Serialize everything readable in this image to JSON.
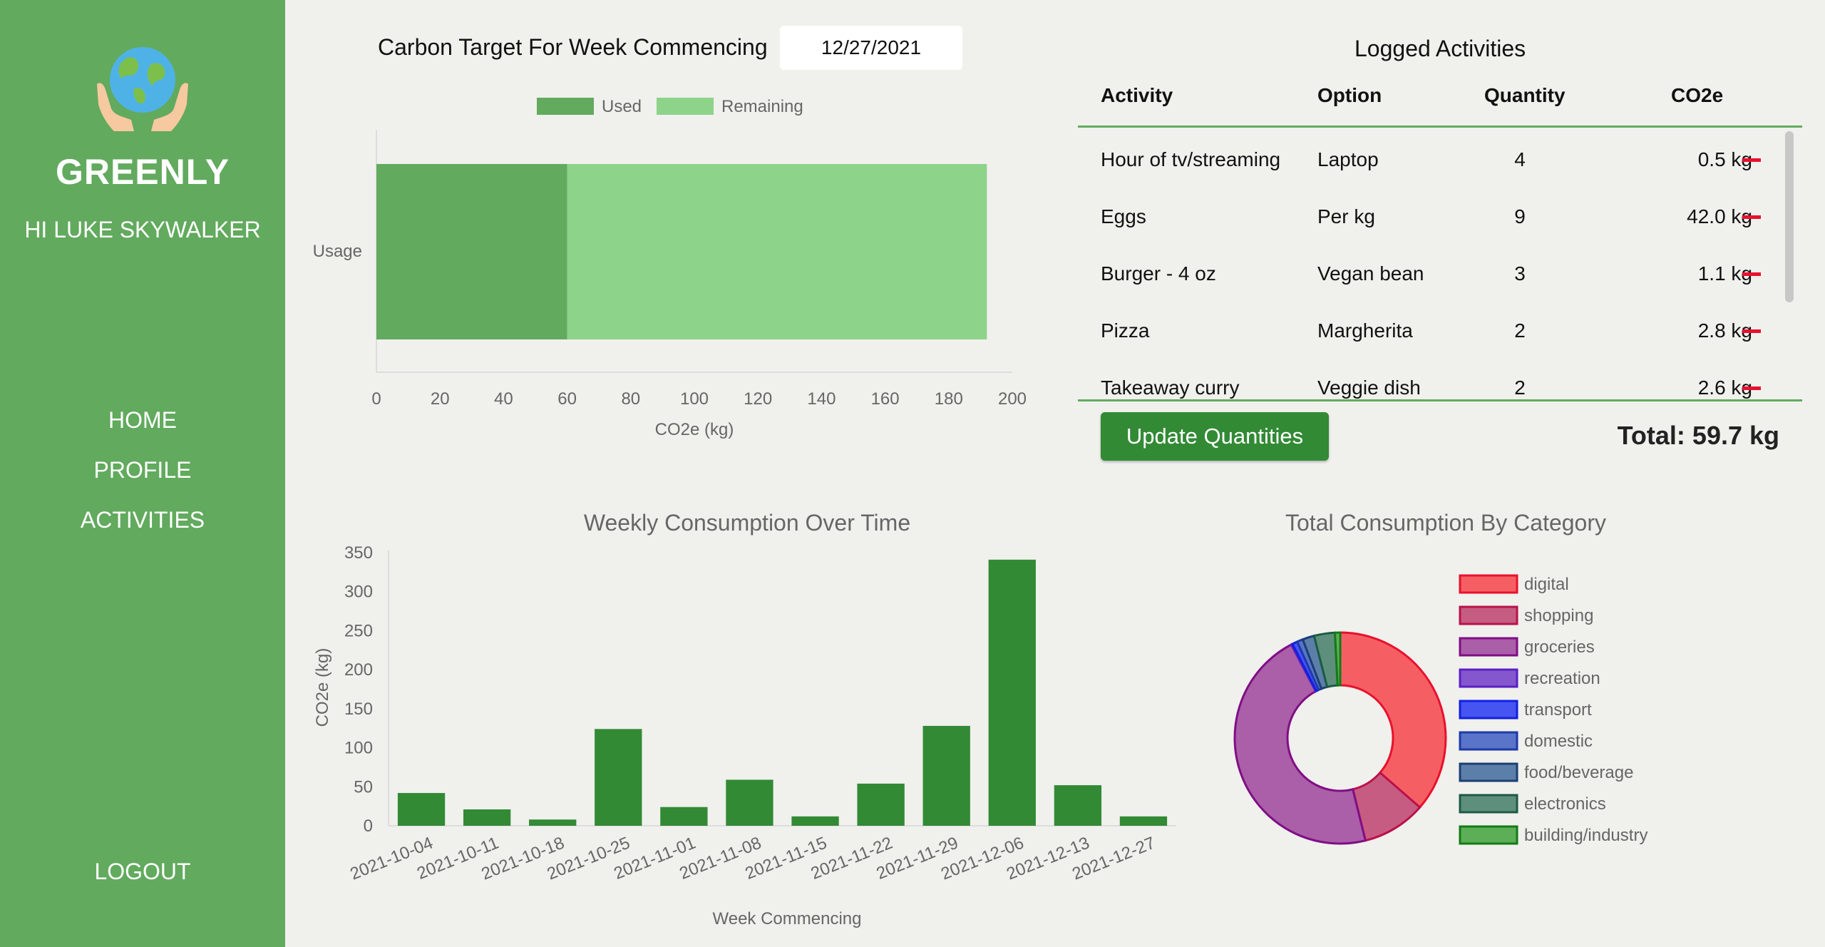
{
  "sidebar": {
    "brand": "GREENLY",
    "greeting": "HI LUKE SKYWALKER",
    "nav": [
      "HOME",
      "PROFILE",
      "ACTIVITIES"
    ],
    "logout": "LOGOUT"
  },
  "target": {
    "label": "Carbon Target For Week Commencing",
    "date": "12/27/2021"
  },
  "usage_chart": {
    "legend": [
      "Used",
      "Remaining"
    ],
    "colors": [
      "#62aa5e",
      "#8dd38a"
    ]
  },
  "activities": {
    "title": "Logged Activities",
    "columns": [
      "Activity",
      "Option",
      "Quantity",
      "CO2e"
    ],
    "rows": [
      {
        "activity": "Hour of tv/streaming",
        "option": "Laptop",
        "quantity": "4",
        "co2e": "0.5 kg"
      },
      {
        "activity": "Eggs",
        "option": "Per kg",
        "quantity": "9",
        "co2e": "42.0 kg"
      },
      {
        "activity": "Burger - 4 oz",
        "option": "Vegan bean",
        "quantity": "3",
        "co2e": "1.1 kg"
      },
      {
        "activity": "Pizza",
        "option": "Margherita",
        "quantity": "2",
        "co2e": "2.8 kg"
      },
      {
        "activity": "Takeaway curry",
        "option": "Veggie dish",
        "quantity": "2",
        "co2e": "2.6 kg"
      }
    ],
    "update_label": "Update Quantities",
    "total": "Total: 59.7 kg"
  },
  "chart_data": [
    {
      "type": "bar",
      "orientation": "horizontal",
      "stacked": true,
      "categories": [
        "Usage"
      ],
      "series": [
        {
          "name": "Used",
          "values": [
            60
          ],
          "color": "#62aa5e"
        },
        {
          "name": "Remaining",
          "values": [
            132
          ],
          "color": "#8dd38a"
        }
      ],
      "xlabel": "CO2e (kg)",
      "xlim": [
        0,
        200
      ],
      "xticks": [
        0,
        20,
        40,
        60,
        80,
        100,
        120,
        140,
        160,
        180,
        200
      ],
      "legend": "top"
    },
    {
      "type": "bar",
      "title": "Weekly Consumption Over Time",
      "xlabel": "Week Commencing",
      "ylabel": "CO2e (kg)",
      "ylim": [
        0,
        350
      ],
      "yticks": [
        0,
        50,
        100,
        150,
        200,
        250,
        300,
        350
      ],
      "categories": [
        "2021-10-04",
        "2021-10-11",
        "2021-10-18",
        "2021-10-25",
        "2021-11-01",
        "2021-11-08",
        "2021-11-15",
        "2021-11-22",
        "2021-11-29",
        "2021-12-06",
        "2021-12-13",
        "2021-12-27"
      ],
      "values": [
        42,
        21,
        8,
        124,
        24,
        59,
        12,
        54,
        128,
        341,
        52,
        12
      ],
      "color": "#328a35"
    },
    {
      "type": "pie",
      "donut": true,
      "title": "Total Consumption By Category",
      "legend": "right",
      "labels": [
        "digital",
        "shopping",
        "groceries",
        "recreation",
        "transport",
        "domestic",
        "food/beverage",
        "electronics",
        "building/industry"
      ],
      "values": [
        36.5,
        9.8,
        46.3,
        0.2,
        0.8,
        0.9,
        1.8,
        3.2,
        0.8
      ],
      "colors": [
        "#f55f64",
        "#c75c82",
        "#aa5fa8",
        "#8557cf",
        "#4655f2",
        "#5a74c9",
        "#5b7fa8",
        "#5e8f7d",
        "#5caf57"
      ],
      "borders": [
        "#e8112d",
        "#b9124a",
        "#800e85",
        "#5a1fc4",
        "#1020e0",
        "#1f3aa8",
        "#1b3f74",
        "#1d5b43",
        "#147a15"
      ]
    }
  ]
}
